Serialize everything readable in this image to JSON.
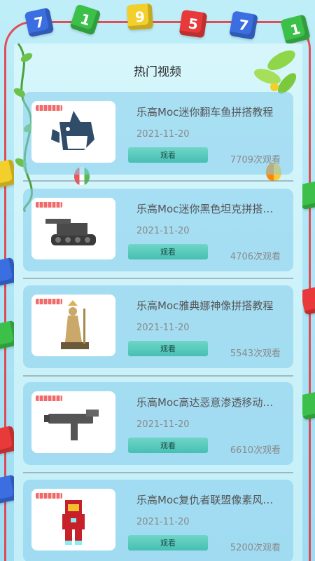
{
  "page_title": "热门视频",
  "cubes": [
    {
      "text": "7",
      "color": "#3b6ee0"
    },
    {
      "text": "1",
      "color": "#3cc04a"
    },
    {
      "text": "9",
      "color": "#f2cf2a"
    },
    {
      "text": "5",
      "color": "#e83a3a"
    },
    {
      "text": "7",
      "color": "#3b6ee0"
    },
    {
      "text": "1",
      "color": "#3cc04a"
    }
  ],
  "videos": [
    {
      "title": "乐高Moc迷你翻车鱼拼搭教程",
      "date": "2021-11-20",
      "button": "观看",
      "views": "7709次观看",
      "icon": "shark-model-icon"
    },
    {
      "title": "乐高Moc迷你黑色坦克拼搭…",
      "date": "2021-11-20",
      "button": "观看",
      "views": "4706次观看",
      "icon": "tank-model-icon"
    },
    {
      "title": "乐高Moc雅典娜神像拼搭教程",
      "date": "2021-11-20",
      "button": "观看",
      "views": "5543次观看",
      "icon": "statue-model-icon"
    },
    {
      "title": "乐高Moc高达恶意渗透移动…",
      "date": "2021-11-20",
      "button": "观看",
      "views": "6610次观看",
      "icon": "gun-model-icon"
    },
    {
      "title": "乐高Moc复仇者联盟像素风…",
      "date": "2021-11-20",
      "button": "观看",
      "views": "5200次观看",
      "icon": "pixel-ironman-icon"
    }
  ]
}
